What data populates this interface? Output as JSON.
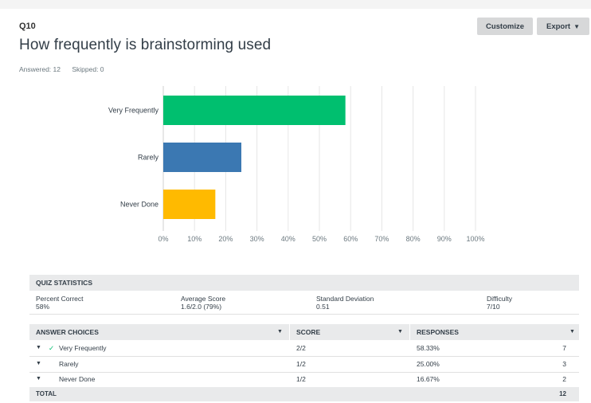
{
  "question": {
    "number": "Q10",
    "title": "How frequently is brainstorming used",
    "answered": "Answered: 12",
    "skipped": "Skipped: 0"
  },
  "toolbar": {
    "customize_label": "Customize",
    "export_label": "Export"
  },
  "chart_data": {
    "type": "bar",
    "orientation": "horizontal",
    "categories": [
      "Very Frequently",
      "Rarely",
      "Never Done"
    ],
    "values": [
      58.33,
      25.0,
      16.67
    ],
    "colors": [
      "#00bf6f",
      "#3b78b2",
      "#ffba00"
    ],
    "xlim": [
      0,
      100
    ],
    "xticks": [
      "0%",
      "10%",
      "20%",
      "30%",
      "40%",
      "50%",
      "60%",
      "70%",
      "80%",
      "90%",
      "100%"
    ],
    "grid": true
  },
  "quiz_stats": {
    "header": "QUIZ STATISTICS",
    "items": [
      {
        "label": "Percent Correct",
        "value": "58%"
      },
      {
        "label": "Average Score",
        "value": "1.6/2.0 (79%)"
      },
      {
        "label": "Standard Deviation",
        "value": "0.51"
      },
      {
        "label": "Difficulty",
        "value": "7/10"
      }
    ]
  },
  "answer_table": {
    "columns": [
      "ANSWER CHOICES",
      "SCORE",
      "RESPONSES"
    ],
    "rows": [
      {
        "choice": "Very Frequently",
        "correct": true,
        "score": "2/2",
        "percent": "58.33%",
        "count": "7"
      },
      {
        "choice": "Rarely",
        "correct": false,
        "score": "1/2",
        "percent": "25.00%",
        "count": "3"
      },
      {
        "choice": "Never Done",
        "correct": false,
        "score": "1/2",
        "percent": "16.67%",
        "count": "2"
      }
    ],
    "total_label": "TOTAL",
    "total_count": "12"
  }
}
